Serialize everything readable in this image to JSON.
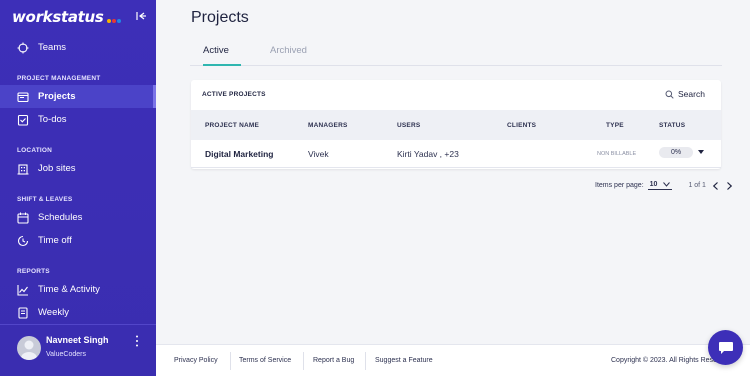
{
  "brand": {
    "name": "workstatus",
    "dot_colors": [
      "#f4b400",
      "#e53935",
      "#1e88e5"
    ]
  },
  "sidebar": {
    "top_items": [
      {
        "label": "Teams",
        "icon": "crosshair-icon"
      }
    ],
    "sections": [
      {
        "title": "PROJECT MANAGEMENT",
        "items": [
          {
            "label": "Projects",
            "icon": "folder-icon",
            "active": true
          },
          {
            "label": "To-dos",
            "icon": "checklist-icon",
            "active": false
          }
        ]
      },
      {
        "title": "LOCATION",
        "items": [
          {
            "label": "Job sites",
            "icon": "building-icon",
            "active": false
          }
        ]
      },
      {
        "title": "SHIFT & LEAVES",
        "items": [
          {
            "label": "Schedules",
            "icon": "calendar-icon",
            "active": false
          },
          {
            "label": "Time off",
            "icon": "clock-icon",
            "active": false
          }
        ]
      },
      {
        "title": "REPORTS",
        "items": [
          {
            "label": "Time & Activity",
            "icon": "chart-line-icon",
            "active": false
          },
          {
            "label": "Weekly",
            "icon": "report-icon",
            "active": false
          }
        ]
      }
    ],
    "user": {
      "name": "Navneet Singh",
      "org": "ValueCoders"
    }
  },
  "main": {
    "title": "Projects",
    "tabs": [
      {
        "label": "Active",
        "active": true
      },
      {
        "label": "Archived",
        "active": false
      }
    ],
    "card": {
      "title": "ACTIVE PROJECTS",
      "search_label": "Search",
      "columns": [
        "PROJECT NAME",
        "MANAGERS",
        "USERS",
        "CLIENTS",
        "TYPE",
        "STATUS"
      ],
      "rows": [
        {
          "project_name": "Digital Marketing",
          "managers": "Vivek",
          "users": "Kirti Yadav , +23",
          "clients": "",
          "type": "NON BILLABLE",
          "status": "0%"
        }
      ]
    },
    "pagination": {
      "items_per_page_label": "Items per page:",
      "items_per_page": "10",
      "range": "1 of 1"
    }
  },
  "footer": {
    "links": [
      "Privacy Policy",
      "Terms of Service",
      "Report a Bug",
      "Suggest a Feature"
    ],
    "copyright": "Copyright © 2023. All Rights Reserved"
  },
  "colors": {
    "sidebar": "#3d2fb8",
    "active_item": "#4b43c8",
    "tab_accent": "#2fb6b0"
  }
}
